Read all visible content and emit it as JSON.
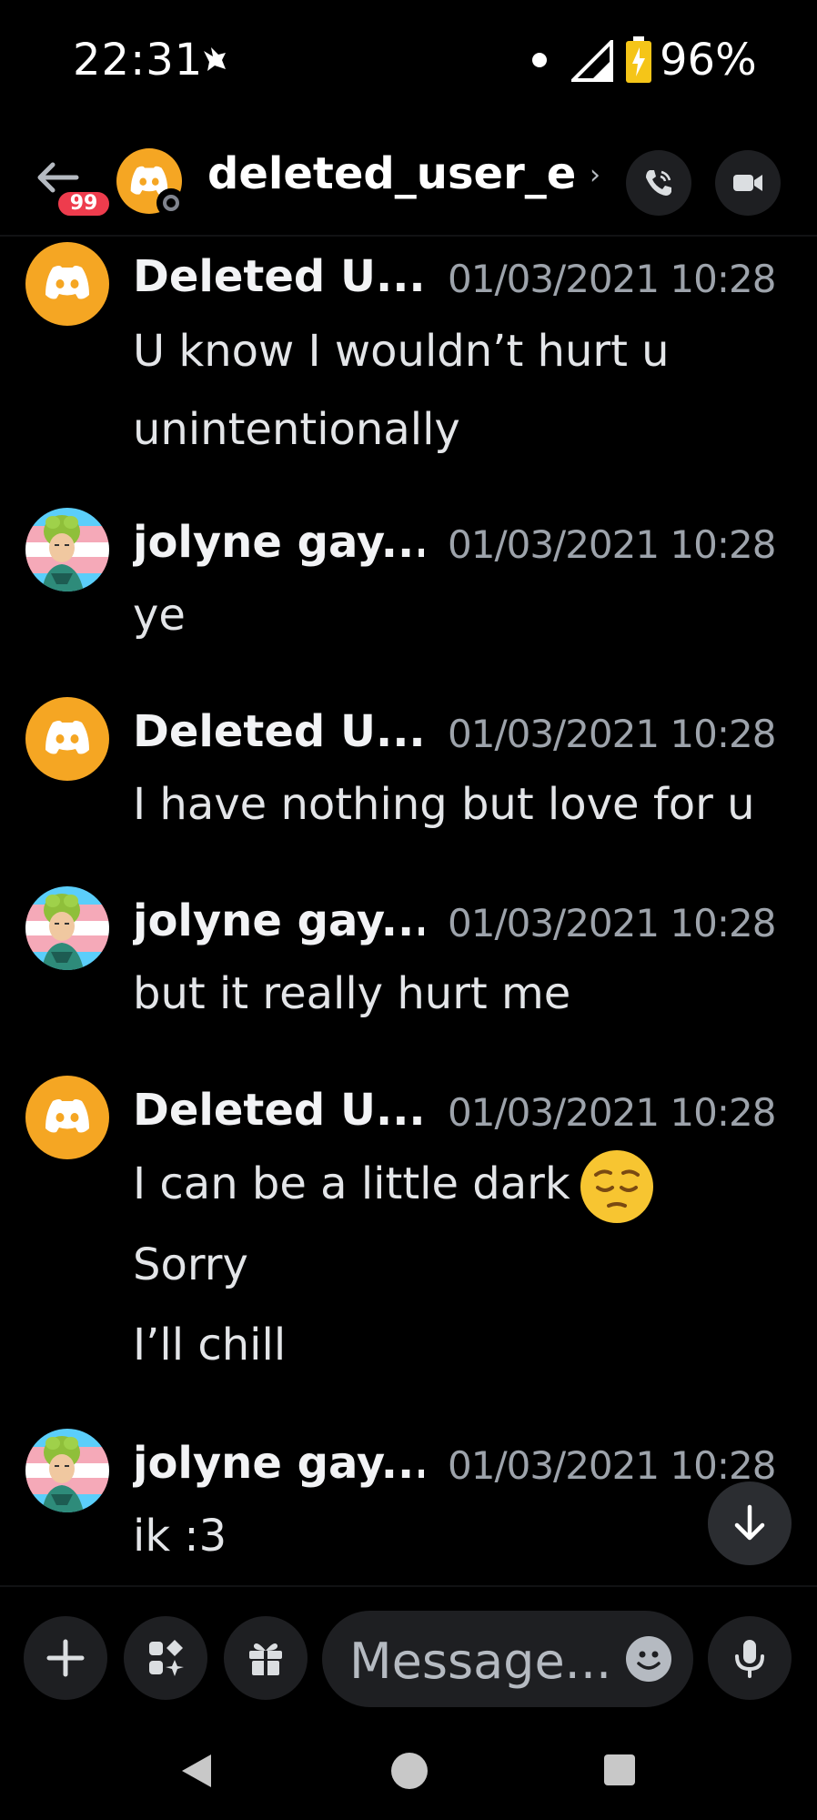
{
  "status_bar": {
    "time": "22:31",
    "battery_percent": "96%",
    "battery_level": 0.96,
    "charging": true
  },
  "header": {
    "unread_badge": "99",
    "title": "deleted_user_e..",
    "chevron": "›",
    "icons": [
      "back-arrow-icon",
      "phone-call-icon",
      "video-camera-icon"
    ]
  },
  "messages": [
    {
      "author": "Deleted U...",
      "avatar": "discord-logo",
      "time": "01/03/2021 10:28",
      "lines": [
        "U know I wouldn’t hurt u",
        "unintentionally"
      ]
    },
    {
      "author": "jolyne gay...",
      "avatar": "jolyne-pfp",
      "time": "01/03/2021 10:28",
      "lines": [
        "ye"
      ]
    },
    {
      "author": "Deleted U...",
      "avatar": "discord-logo",
      "time": "01/03/2021 10:28",
      "lines": [
        "I have nothing but love for u"
      ]
    },
    {
      "author": "jolyne gay...",
      "avatar": "jolyne-pfp",
      "time": "01/03/2021 10:28",
      "lines": [
        "but it really hurt me"
      ]
    },
    {
      "author": "Deleted U...",
      "avatar": "discord-logo",
      "time": "01/03/2021 10:28",
      "lines": [
        "I can be a little dark",
        "Sorry",
        "I’ll chill"
      ],
      "emoji": "pensive-face"
    },
    {
      "author": "jolyne gay...",
      "avatar": "jolyne-pfp",
      "time": "01/03/2021 10:28",
      "lines": [
        "ik :3"
      ]
    }
  ],
  "composer": {
    "placeholder": "Message...",
    "icons": [
      "plus-icon",
      "apps-icon",
      "gift-icon",
      "emoji-icon",
      "microphone-icon"
    ]
  },
  "colors": {
    "discord_orange": "#f5a623",
    "badge_red": "#ee3c4d",
    "timestamp_gray": "#9da3ab",
    "button_bg": "#1e1f22"
  }
}
